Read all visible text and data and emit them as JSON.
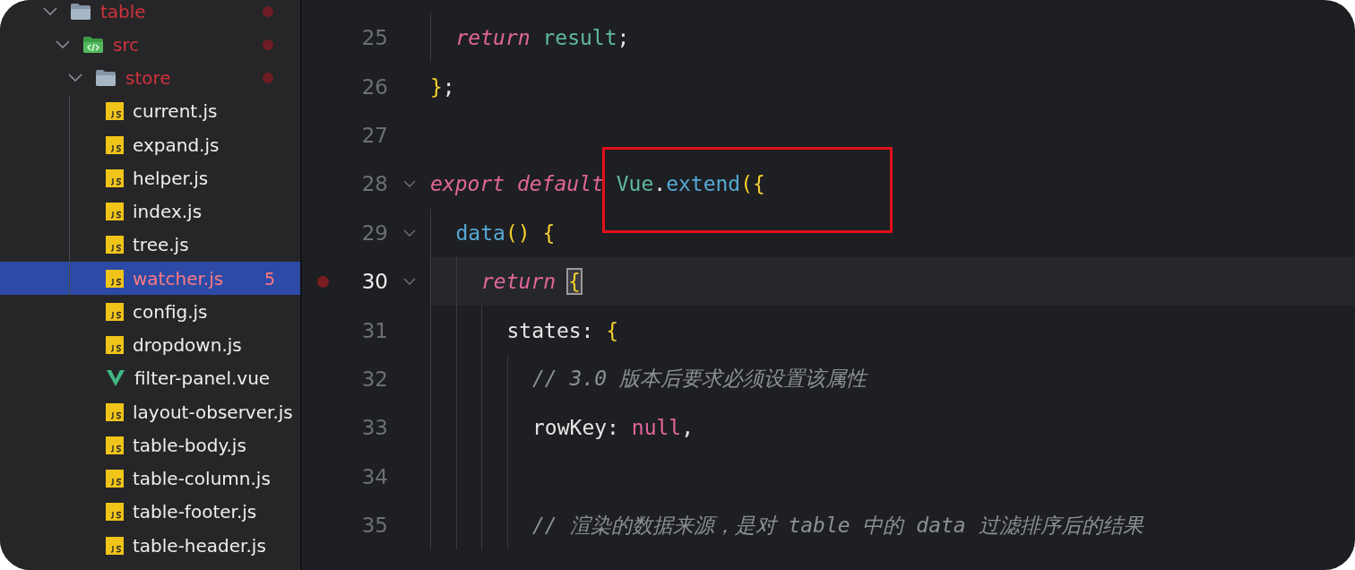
{
  "explorer": {
    "tree": [
      {
        "name": "table",
        "kind": "folder",
        "expanded": true,
        "modified": true,
        "selected": false,
        "children": [
          {
            "name": "src",
            "kind": "source-folder",
            "expanded": true,
            "modified": true,
            "selected": false,
            "children": [
              {
                "name": "store",
                "kind": "folder",
                "expanded": true,
                "modified": true,
                "selected": false,
                "children": [
                  {
                    "name": "current.js",
                    "kind": "js",
                    "modified": false,
                    "selected": false
                  },
                  {
                    "name": "expand.js",
                    "kind": "js",
                    "modified": false,
                    "selected": false
                  },
                  {
                    "name": "helper.js",
                    "kind": "js",
                    "modified": false,
                    "selected": false
                  },
                  {
                    "name": "index.js",
                    "kind": "js",
                    "modified": false,
                    "selected": false
                  },
                  {
                    "name": "tree.js",
                    "kind": "js",
                    "modified": false,
                    "selected": false
                  },
                  {
                    "name": "watcher.js",
                    "kind": "js",
                    "modified": true,
                    "selected": true,
                    "badge": "5"
                  }
                ]
              },
              {
                "name": "config.js",
                "kind": "js",
                "modified": false,
                "selected": false
              },
              {
                "name": "dropdown.js",
                "kind": "js",
                "modified": false,
                "selected": false
              },
              {
                "name": "filter-panel.vue",
                "kind": "vue",
                "modified": false,
                "selected": false
              },
              {
                "name": "layout-observer.js",
                "kind": "js",
                "modified": false,
                "selected": false
              },
              {
                "name": "table-body.js",
                "kind": "js",
                "modified": false,
                "selected": false
              },
              {
                "name": "table-column.js",
                "kind": "js",
                "modified": false,
                "selected": false
              },
              {
                "name": "table-footer.js",
                "kind": "js",
                "modified": false,
                "selected": false
              },
              {
                "name": "table-header.js",
                "kind": "js",
                "modified": false,
                "selected": false
              }
            ]
          }
        ]
      }
    ]
  },
  "editor": {
    "lines": [
      {
        "number": "25",
        "current": false,
        "breakpoint": false,
        "foldable": false,
        "tokens": [
          {
            "text": "  return ",
            "kind": "keyword"
          },
          {
            "text": "result",
            "kind": "variable"
          },
          {
            "text": ";",
            "kind": "plain"
          }
        ]
      },
      {
        "number": "26",
        "current": false,
        "breakpoint": false,
        "foldable": false,
        "tokens": [
          {
            "text": "}",
            "kind": "brace"
          },
          {
            "text": ";",
            "kind": "plain"
          }
        ]
      },
      {
        "number": "27",
        "current": false,
        "breakpoint": false,
        "foldable": false
      },
      {
        "number": "28",
        "current": false,
        "breakpoint": false,
        "foldable": true,
        "tokens": [
          {
            "text": "export default ",
            "kind": "keyword"
          },
          {
            "text": "Vue",
            "kind": "variable",
            "highlighted": true
          },
          {
            "text": ".",
            "kind": "plain",
            "highlighted": true
          },
          {
            "text": "extend",
            "kind": "function",
            "highlighted": true
          },
          {
            "text": "({",
            "kind": "brace",
            "highlighted": true
          }
        ]
      },
      {
        "number": "29",
        "current": false,
        "breakpoint": false,
        "foldable": true,
        "tokens": [
          {
            "text": "  data",
            "kind": "function"
          },
          {
            "text": "() {",
            "kind": "brace"
          }
        ]
      },
      {
        "number": "30",
        "current": true,
        "breakpoint": true,
        "foldable": true,
        "tokens": [
          {
            "text": "    return ",
            "kind": "keyword"
          },
          {
            "text": "{",
            "kind": "brace-match"
          }
        ]
      },
      {
        "number": "31",
        "current": false,
        "breakpoint": false,
        "foldable": false,
        "tokens": [
          {
            "text": "      states: ",
            "kind": "plain"
          },
          {
            "text": "{",
            "kind": "brace"
          }
        ]
      },
      {
        "number": "32",
        "current": false,
        "breakpoint": false,
        "foldable": false,
        "tokens": [
          {
            "text": "        // 3.0 版本后要求必须设置该属性",
            "kind": "comment"
          }
        ]
      },
      {
        "number": "33",
        "current": false,
        "breakpoint": false,
        "foldable": false,
        "tokens": [
          {
            "text": "        rowKey: ",
            "kind": "plain"
          },
          {
            "text": "null",
            "kind": "literal"
          },
          {
            "text": ",",
            "kind": "plain"
          }
        ]
      },
      {
        "number": "34",
        "current": false,
        "breakpoint": false,
        "foldable": false
      },
      {
        "number": "35",
        "current": false,
        "breakpoint": false,
        "foldable": false,
        "tokens": [
          {
            "text": "        // 渲染的数据来源，是对 table 中的 data 过滤排序后的结果",
            "kind": "comment"
          }
        ]
      }
    ]
  }
}
